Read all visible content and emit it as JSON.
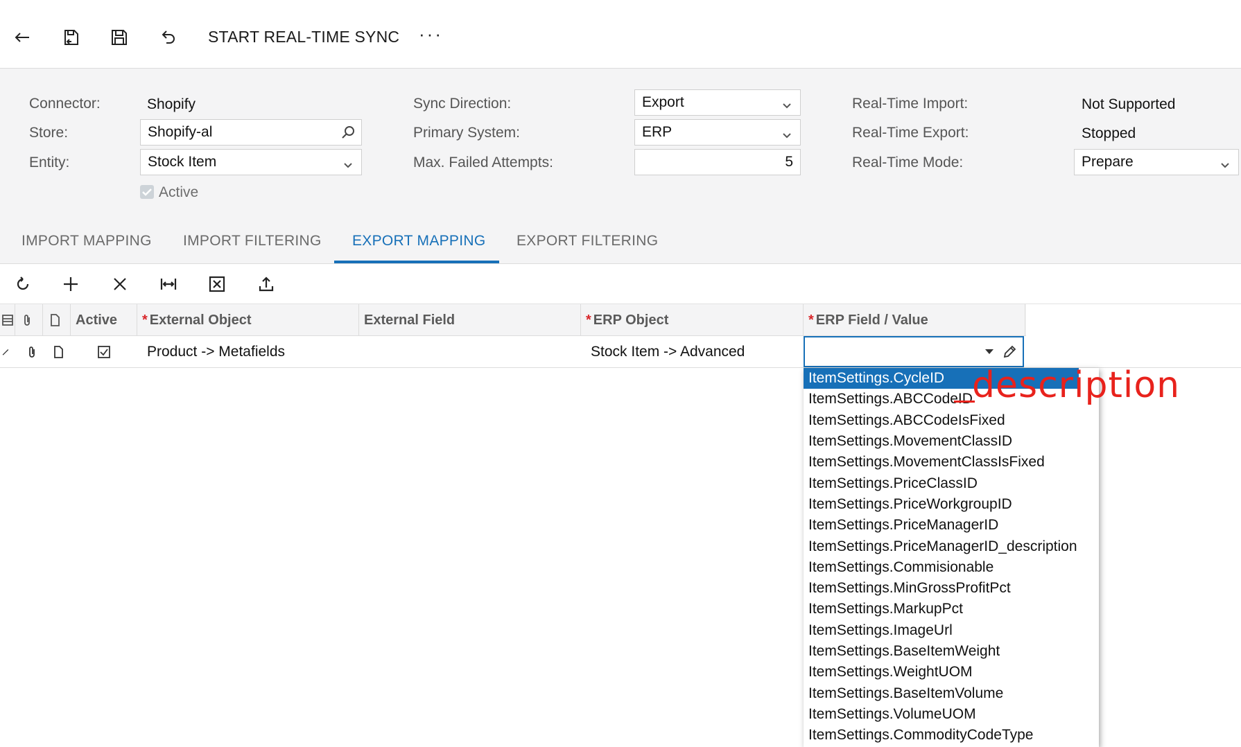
{
  "toolbar": {
    "start_sync_label": "START REAL-TIME SYNC",
    "more_label": "···",
    "icons": [
      "back-icon",
      "save-close-icon",
      "save-icon",
      "undo-icon"
    ]
  },
  "form": {
    "connector_label": "Connector:",
    "connector_value": "Shopify",
    "store_label": "Store:",
    "store_value": "Shopify-al",
    "entity_label": "Entity:",
    "entity_value": "Stock Item",
    "active_label": "Active",
    "sync_direction_label": "Sync Direction:",
    "sync_direction_value": "Export",
    "primary_system_label": "Primary System:",
    "primary_system_value": "ERP",
    "max_failed_label": "Max. Failed Attempts:",
    "max_failed_value": "5",
    "rt_import_label": "Real-Time Import:",
    "rt_import_value": "Not Supported",
    "rt_export_label": "Real-Time Export:",
    "rt_export_value": "Stopped",
    "rt_mode_label": "Real-Time Mode:",
    "rt_mode_value": "Prepare"
  },
  "tabs": [
    {
      "label": "IMPORT MAPPING",
      "active": false
    },
    {
      "label": "IMPORT FILTERING",
      "active": false
    },
    {
      "label": "EXPORT MAPPING",
      "active": true
    },
    {
      "label": "EXPORT FILTERING",
      "active": false
    }
  ],
  "grid": {
    "columns": {
      "active": "Active",
      "external_object": "External Object",
      "external_field": "External Field",
      "erp_object": "ERP Object",
      "erp_field": "ERP Field / Value",
      "required_mark": "*"
    },
    "rows": [
      {
        "external_object": "Product -> Metafields",
        "external_field": "",
        "erp_object": "Stock Item -> Advanced",
        "erp_field": ""
      }
    ]
  },
  "dropdown": {
    "selected_index": 0,
    "options": [
      "ItemSettings.CycleID",
      "ItemSettings.ABCCodeID",
      "ItemSettings.ABCCodeIsFixed",
      "ItemSettings.MovementClassID",
      "ItemSettings.MovementClassIsFixed",
      "ItemSettings.PriceClassID",
      "ItemSettings.PriceWorkgroupID",
      "ItemSettings.PriceManagerID",
      "ItemSettings.PriceManagerID_description",
      "ItemSettings.Commisionable",
      "ItemSettings.MinGrossProfitPct",
      "ItemSettings.MarkupPct",
      "ItemSettings.ImageUrl",
      "ItemSettings.BaseItemWeight",
      "ItemSettings.WeightUOM",
      "ItemSettings.BaseItemVolume",
      "ItemSettings.VolumeUOM",
      "ItemSettings.CommodityCodeType"
    ]
  },
  "annotation": {
    "text": "description",
    "color": "#e8221c"
  },
  "colors": {
    "accent": "#1770b8",
    "required": "#d8262a"
  }
}
